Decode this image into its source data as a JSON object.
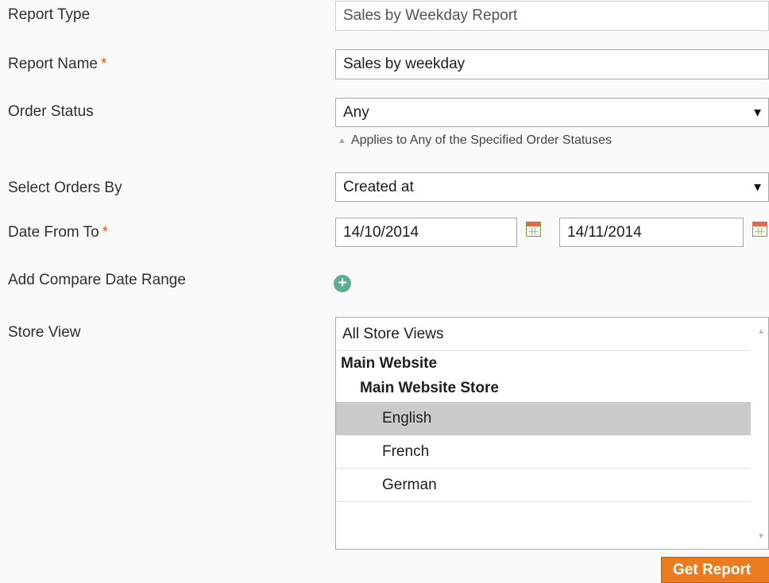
{
  "labels": {
    "report_type": "Report Type",
    "report_name": "Report Name",
    "order_status": "Order Status",
    "select_orders_by": "Select Orders By",
    "date_from_to": "Date From To",
    "add_compare": "Add Compare Date Range",
    "store_view": "Store View",
    "required_mark": "*"
  },
  "fields": {
    "report_type_value": "Sales by Weekday Report",
    "report_name_value": "Sales by weekday",
    "order_status_value": "Any",
    "order_status_hint": "Applies to Any of the Specified Order Statuses",
    "select_orders_by_value": "Created at",
    "date_from": "14/10/2014",
    "date_to": "14/11/2014"
  },
  "store_view": {
    "options": [
      {
        "label": "All Store Views",
        "type": "option",
        "selected": false
      },
      {
        "label": "Main Website",
        "type": "group",
        "selected": false
      },
      {
        "label": "Main Website Store",
        "type": "group",
        "selected": false
      },
      {
        "label": "English",
        "type": "option",
        "selected": true
      },
      {
        "label": "French",
        "type": "option",
        "selected": false
      },
      {
        "label": "German",
        "type": "option",
        "selected": false
      }
    ]
  },
  "buttons": {
    "get_report": "Get Report"
  },
  "icons": {
    "dropdown": "triangle-down-icon",
    "calendar": "calendar-icon",
    "add": "plus-circle-icon",
    "hint": "triangle-up-icon"
  },
  "colors": {
    "accent": "#eb7b1f",
    "required": "#eb5202",
    "add_button": "#5dae8b",
    "selected_option": "#cacaca"
  }
}
